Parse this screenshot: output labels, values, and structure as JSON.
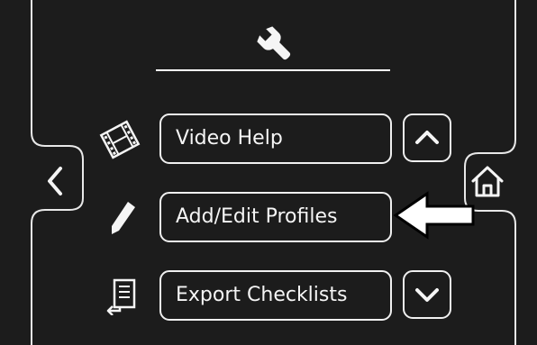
{
  "menu": {
    "video_help_label": "Video Help",
    "add_edit_profiles_label": "Add/Edit Profiles",
    "export_checklists_label": "Export Checklists"
  },
  "icons": {
    "header": "wrench-icon",
    "video_help": "film-icon",
    "add_edit_profiles": "pencil-icon",
    "export_checklists": "export-list-icon",
    "back": "chevron-left-icon",
    "home": "home-icon",
    "scroll_up": "chevron-up-icon",
    "scroll_down": "chevron-down-icon",
    "callout": "pointer-arrow-icon"
  },
  "colors": {
    "background": "#1c1c1c",
    "foreground": "#f0f0f0",
    "callout_fill": "#ffffff",
    "callout_stroke": "#000000"
  }
}
